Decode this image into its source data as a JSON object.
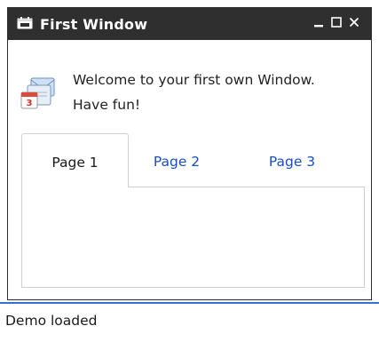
{
  "window": {
    "title": "First Window",
    "title_icon": "calendar-icon",
    "controls": {
      "minimize_icon": "minimize-icon",
      "maximize_icon": "maximize-icon",
      "close_icon": "close-icon"
    }
  },
  "message": {
    "icon": "calendar-mail-icon",
    "line1": "Welcome to your first own Window.",
    "line2": "Have fun!"
  },
  "tabs": [
    {
      "label": "Page 1",
      "active": true
    },
    {
      "label": "Page 2",
      "active": false
    },
    {
      "label": "Page 3",
      "active": false
    }
  ],
  "status": {
    "text": "Demo loaded"
  },
  "colors": {
    "titlebar": "#2f2f2f",
    "tab_link": "#1a4fb8",
    "status_border": "#3a6fd1"
  }
}
